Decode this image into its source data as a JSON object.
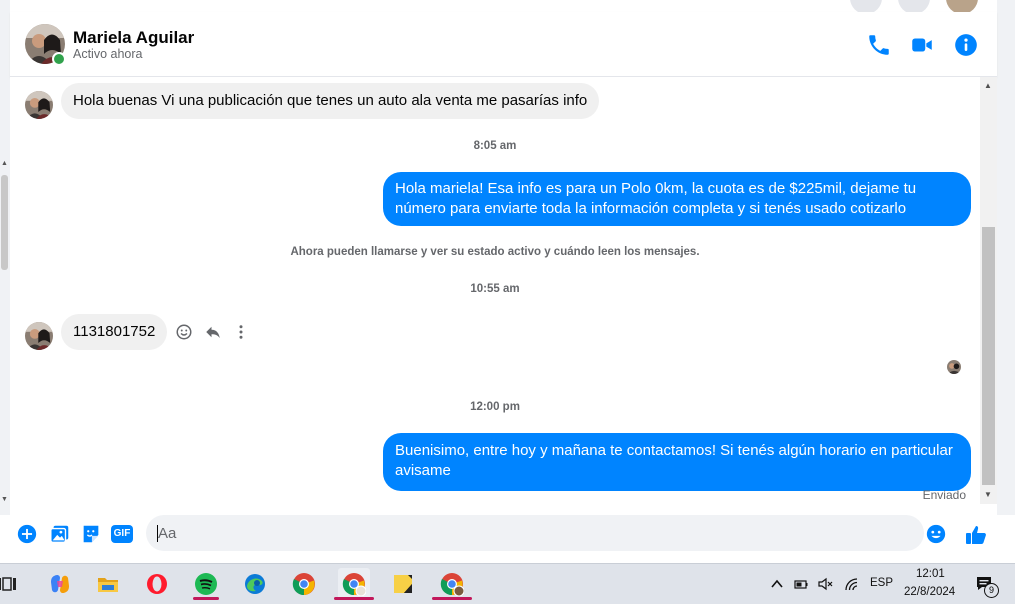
{
  "contact": {
    "name": "Mariela Aguilar",
    "status": "Activo ahora"
  },
  "header_icons": [
    "phone-icon",
    "video-camera-icon",
    "info-icon"
  ],
  "colors": {
    "accent": "#0084ff",
    "incoming_bubble": "#f0f0f0",
    "online": "#31a24c"
  },
  "messages": {
    "m1": "Hola buenas Vi una publicación que tenes un auto ala venta me pasarías info",
    "t1": "8:05 am",
    "m2_line1": "Hola mariela! Esa info es para un Polo 0km, la cuota es de $225mil, dejame tu",
    "m2_line2": "número para enviarte toda la información completa y si tenés usado cotizarlo",
    "sys": "Ahora pueden llamarse y ver su estado activo y cuándo leen los mensajes.",
    "t2": "10:55 am",
    "m3": "1131801752",
    "t3": "12:00 pm",
    "m4_line1": "Buenisimo, entre hoy y mañana te contactamos! Si tenés algún horario en particular",
    "m4_line2": "avisame",
    "status": "Enviado"
  },
  "composer": {
    "placeholder": "Aa",
    "gif_label": "GIF"
  },
  "taskbar": {
    "apps": [
      "task-view-icon",
      "copilot-icon",
      "file-explorer-icon",
      "opera-icon",
      "spotify-icon",
      "edge-icon",
      "chrome-icon",
      "chrome-profile-icon",
      "sticky-notes-icon",
      "chrome-profile2-icon"
    ],
    "lang": "ESP",
    "time": "12:01",
    "date": "22/8/2024",
    "notif_count": "9"
  }
}
